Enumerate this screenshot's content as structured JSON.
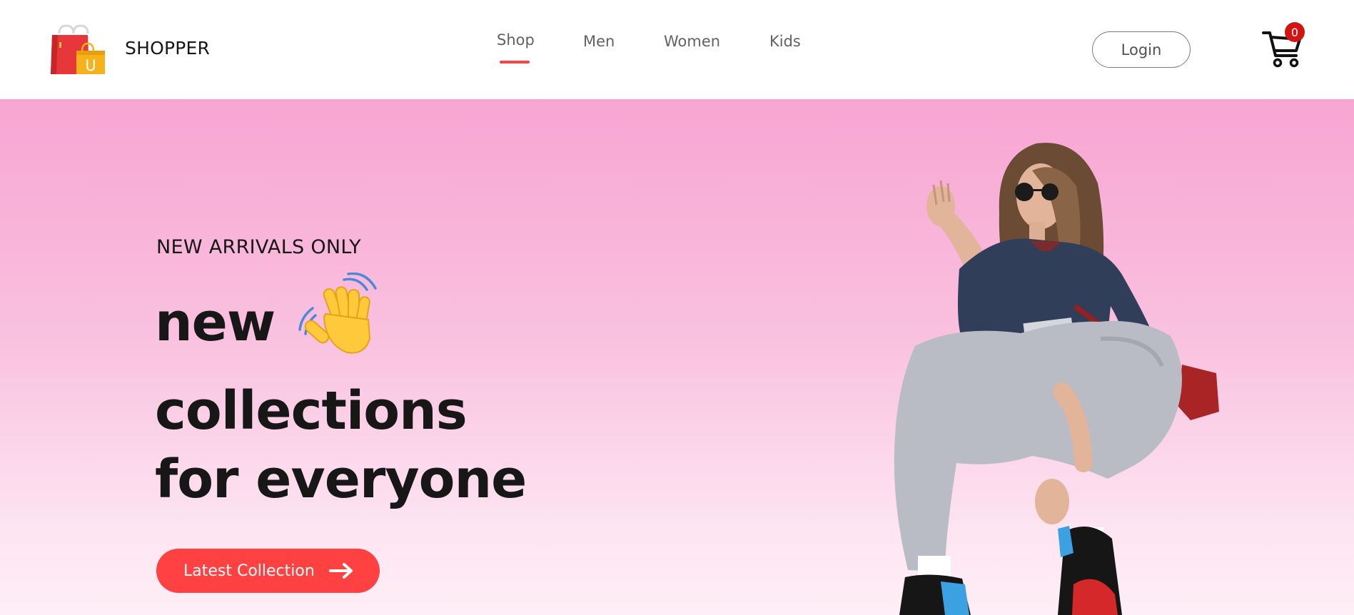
{
  "brand": {
    "name": "SHOPPER",
    "logo_letter": "U"
  },
  "nav": {
    "items": [
      {
        "label": "Shop",
        "active": true
      },
      {
        "label": "Men",
        "active": false
      },
      {
        "label": "Women",
        "active": false
      },
      {
        "label": "Kids",
        "active": false
      }
    ]
  },
  "header": {
    "login_label": "Login",
    "cart_count": "0"
  },
  "hero": {
    "eyebrow": "NEW ARRIVALS ONLY",
    "line1": "new",
    "line2": "collections",
    "line3": "for everyone",
    "cta_label": "Latest Collection"
  },
  "icons": {
    "logo": "shopping-bag-icon",
    "cart": "cart-icon",
    "wave": "waving-hand-icon",
    "cta": "arrow-right-icon"
  },
  "colors": {
    "accent": "#ff4141",
    "badge": "#d31212",
    "hero_top": "#f8a5d2",
    "hero_bottom": "#feeef6",
    "text": "#171717",
    "nav_text": "#626262"
  }
}
